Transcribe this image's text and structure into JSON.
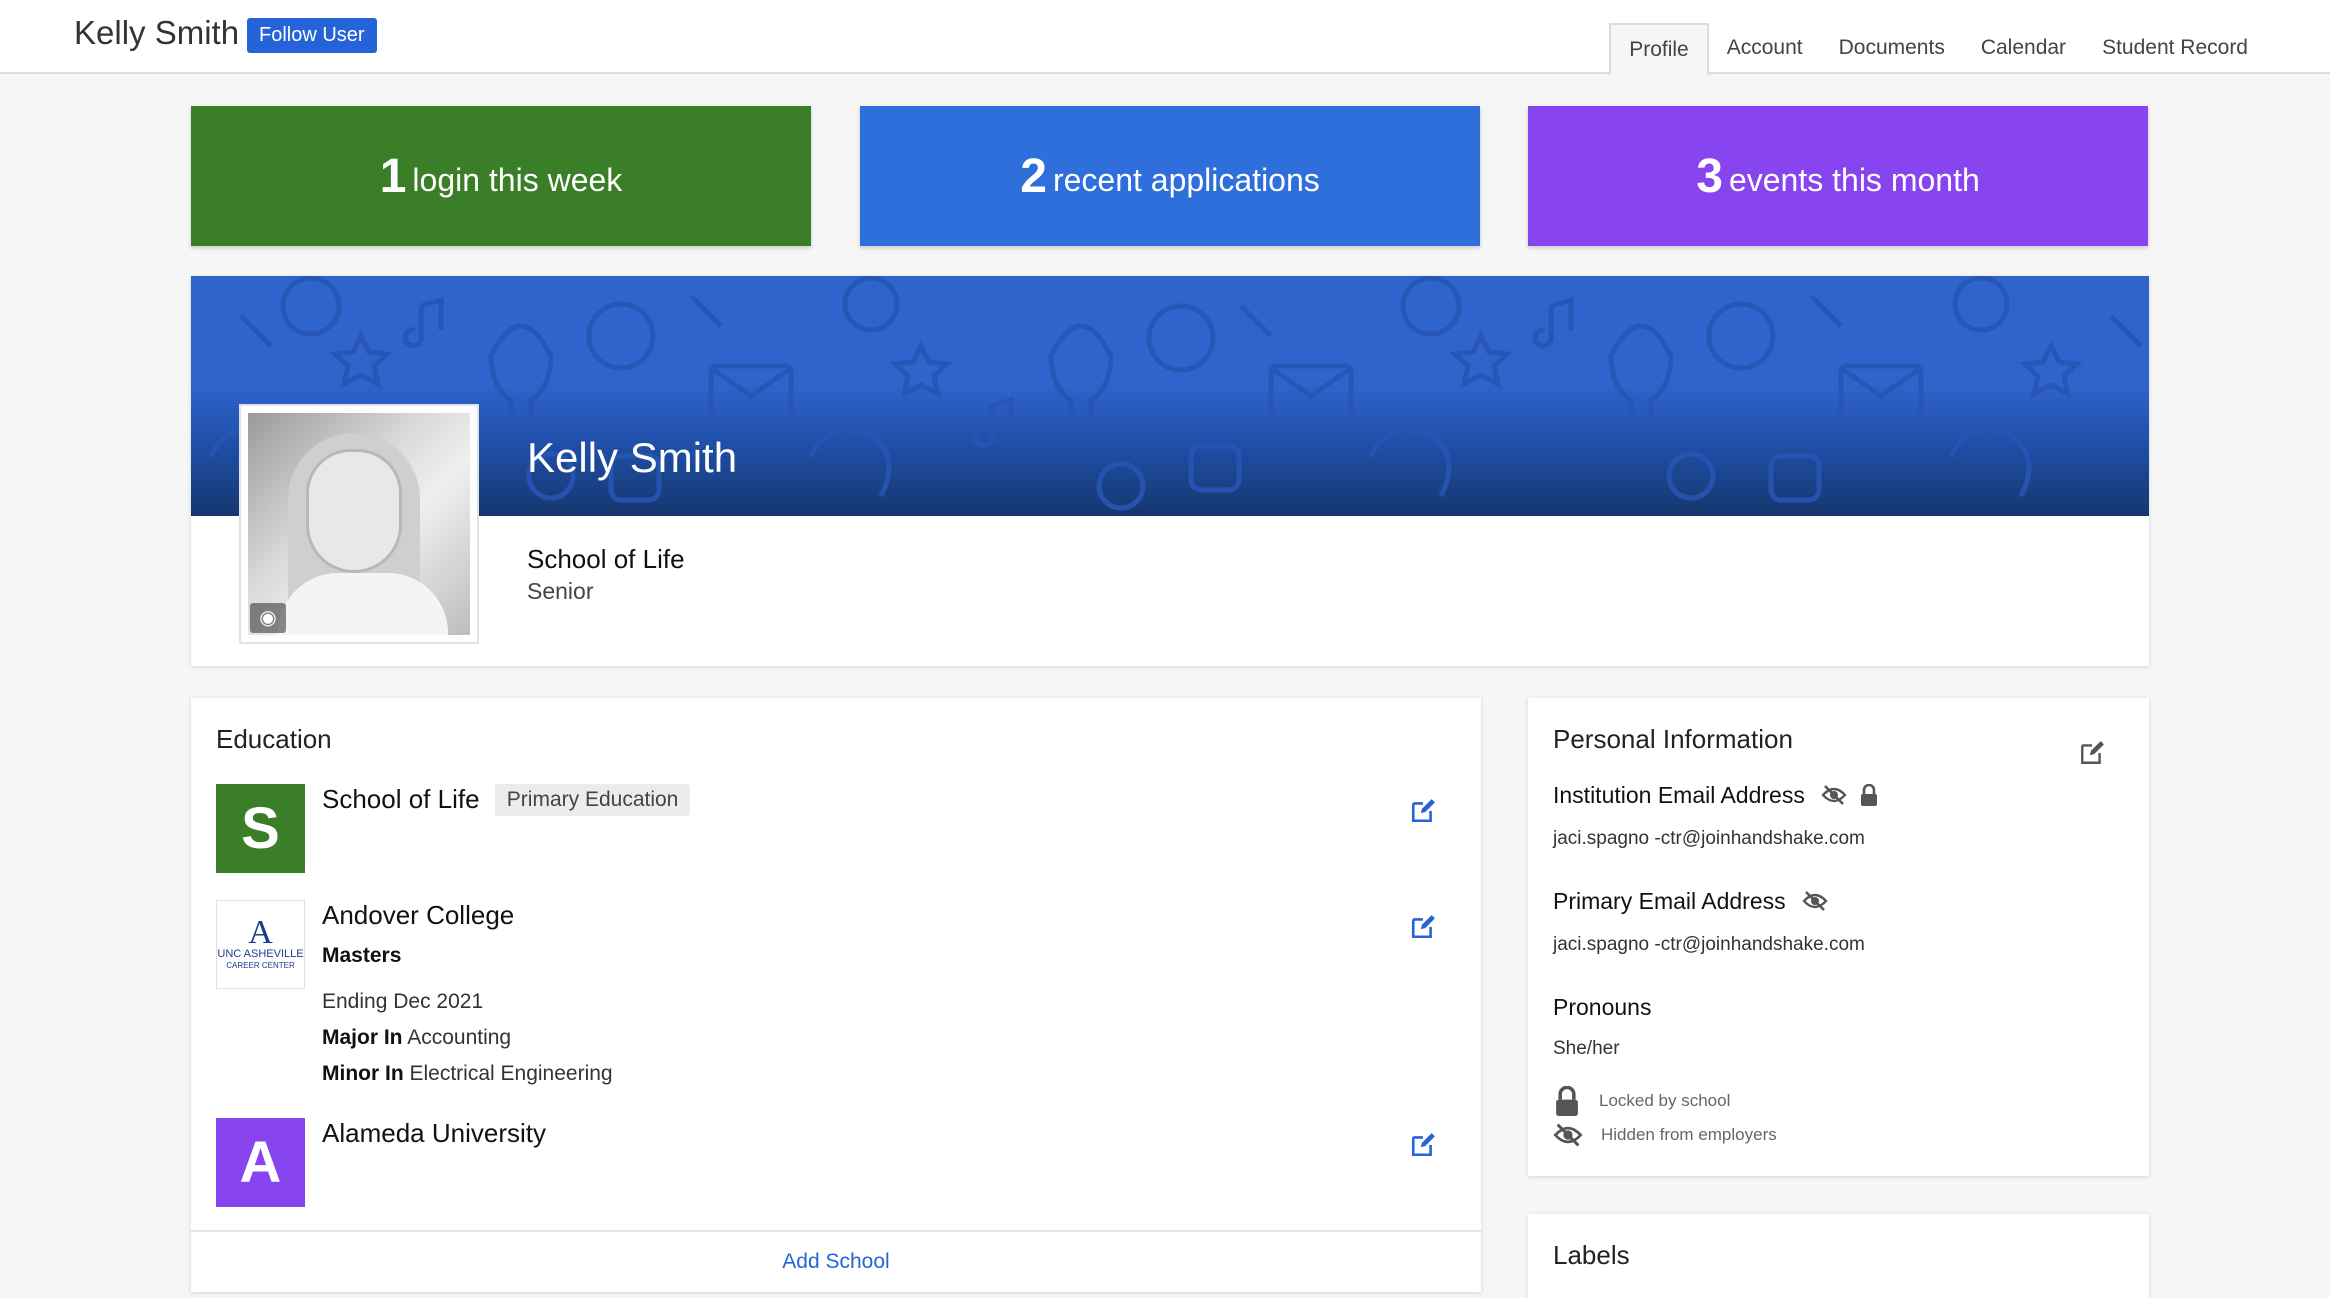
{
  "topbar": {
    "user_name": "Kelly Smith",
    "follow_label": "Follow User",
    "tabs": [
      {
        "label": "Profile",
        "active": true
      },
      {
        "label": "Account"
      },
      {
        "label": "Documents"
      },
      {
        "label": "Calendar"
      },
      {
        "label": "Student Record"
      }
    ]
  },
  "stats": [
    {
      "number": "1",
      "text": "login this week",
      "color": "#3a7e27"
    },
    {
      "number": "2",
      "text": "recent applications",
      "color": "#2e6fdb"
    },
    {
      "number": "3",
      "text": "events this month",
      "color": "#8844ee"
    }
  ],
  "profile": {
    "name": "Kelly Smith",
    "school": "School of Life",
    "year": "Senior",
    "avatar_icon": "camera-icon"
  },
  "education": {
    "title": "Education",
    "items": [
      {
        "logo_letter": "S",
        "logo_color": "#3a7e27",
        "name": "School of Life",
        "badge": "Primary Education"
      },
      {
        "logo_text": "UNC ASHEVILLE",
        "logo_subtext": "CAREER CENTER",
        "name": "Andover College",
        "degree": "Masters",
        "ending": "Ending Dec 2021",
        "major_label": "Major In",
        "major": "Accounting",
        "minor_label": "Minor In",
        "minor": "Electrical Engineering"
      },
      {
        "logo_letter": "A",
        "logo_color": "#8844ee",
        "name": "Alameda University"
      }
    ],
    "add_label": "Add School"
  },
  "personal": {
    "title": "Personal Information",
    "institution_email_label": "Institution Email Address",
    "institution_email": "jaci.spagno    -ctr@joinhandshake.com",
    "primary_email_label": "Primary Email Address",
    "primary_email": "jaci.spagno    -ctr@joinhandshake.com",
    "pronouns_label": "Pronouns",
    "pronouns": "She/her",
    "legend_locked": "Locked by school",
    "legend_hidden": "Hidden from employers"
  },
  "labels": {
    "title": "Labels"
  },
  "colors": {
    "accent": "#2563d9",
    "green": "#3a7e27",
    "blue": "#2e6fdb",
    "purple": "#8844ee"
  }
}
